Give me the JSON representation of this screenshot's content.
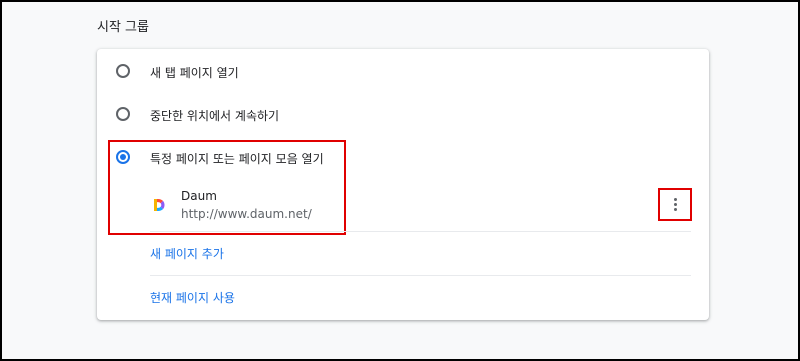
{
  "section": {
    "title": "시작 그룹"
  },
  "options": [
    {
      "label": "새 탭 페이지 열기",
      "checked": false
    },
    {
      "label": "중단한 위치에서 계속하기",
      "checked": false
    },
    {
      "label": "특정 페이지 또는 페이지 모음 열기",
      "checked": true
    }
  ],
  "pages": [
    {
      "name": "Daum",
      "url": "http://www.daum.net/",
      "icon": "daum-favicon-icon"
    }
  ],
  "actions": {
    "add_page": "새 페이지 추가",
    "use_current": "현재 페이지 사용"
  },
  "colors": {
    "accent": "#1a73e8",
    "highlight": "#e00000"
  }
}
